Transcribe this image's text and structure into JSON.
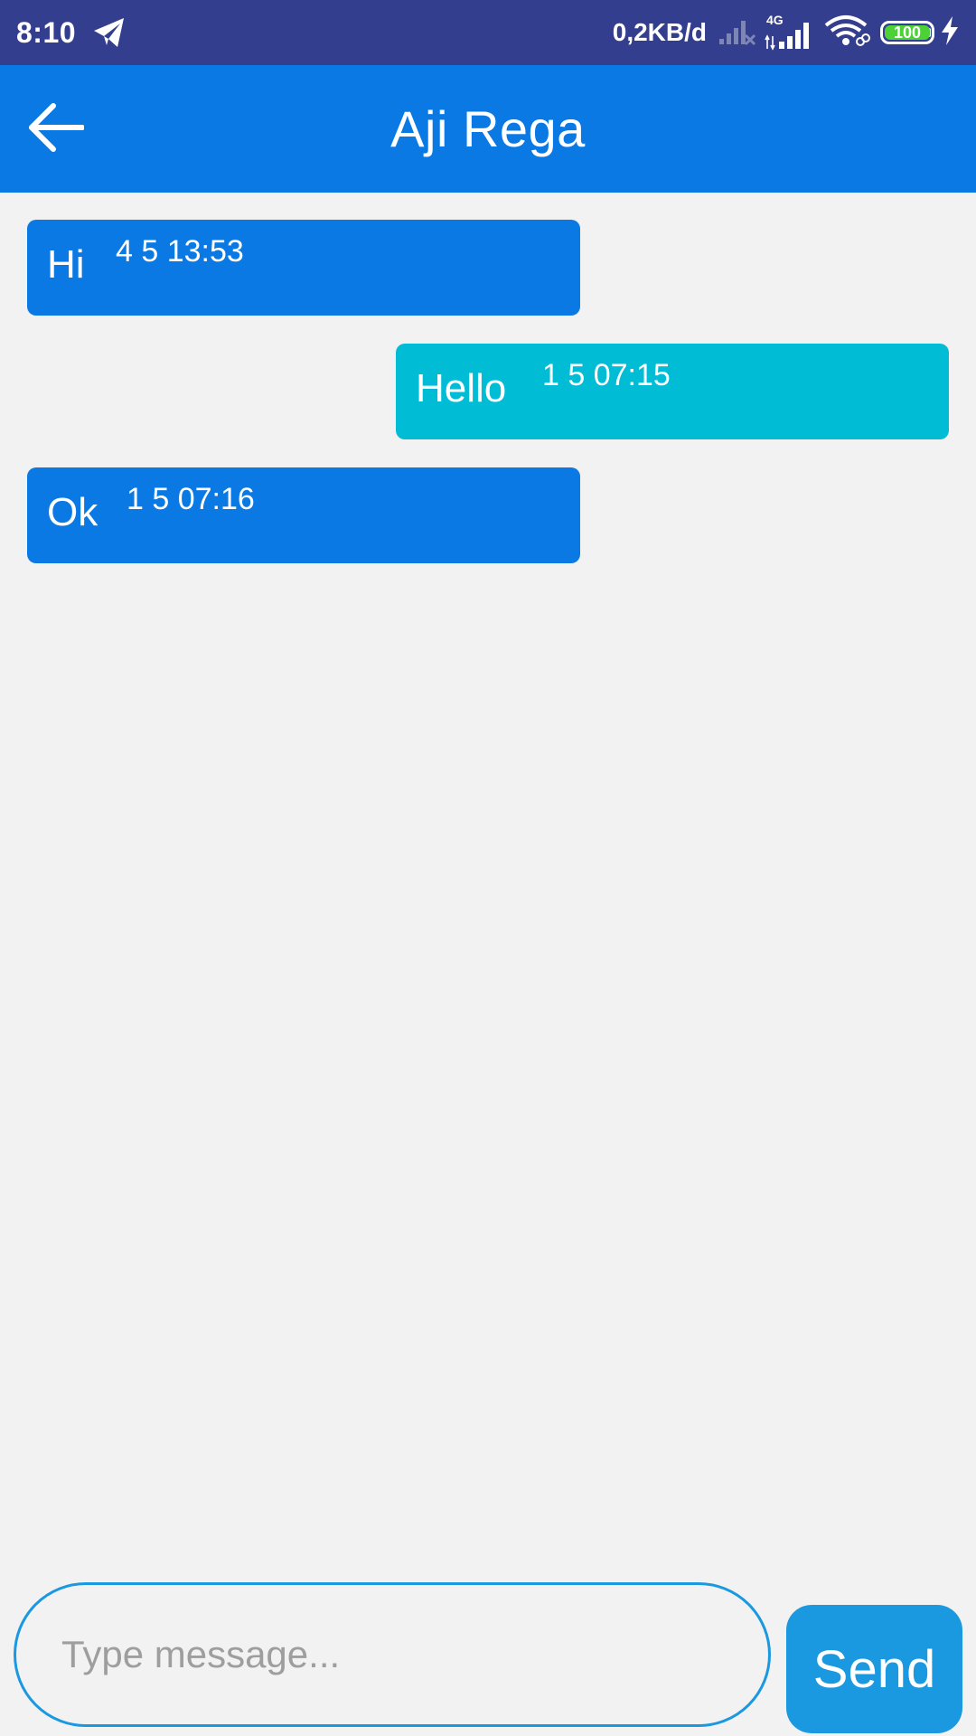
{
  "status_bar": {
    "time": "8:10",
    "net_speed": "0,2KB/d",
    "network_type": "4G",
    "battery_level": "100",
    "icons": [
      "telegram-icon",
      "signal-off-icon",
      "signal-icon",
      "wifi-icon",
      "battery-icon",
      "charging-icon"
    ],
    "colors": {
      "background": "#343e8e",
      "battery_fill": "#4cd137"
    }
  },
  "app_bar": {
    "title": "Aji Rega",
    "back_icon": "arrow-left-icon",
    "color": "#0a79e4"
  },
  "messages": [
    {
      "direction": "incoming",
      "text": "Hi",
      "time": "4 5 13:53",
      "color": "#0a79e4"
    },
    {
      "direction": "outgoing",
      "text": "Hello",
      "time": "1 5 07:15",
      "color": "#00bcd4"
    },
    {
      "direction": "incoming",
      "text": "Ok",
      "time": "1 5 07:16",
      "color": "#0a79e4"
    }
  ],
  "composer": {
    "placeholder": "Type message...",
    "value": "",
    "send_label": "Send",
    "accent_color": "#1a98e0"
  }
}
